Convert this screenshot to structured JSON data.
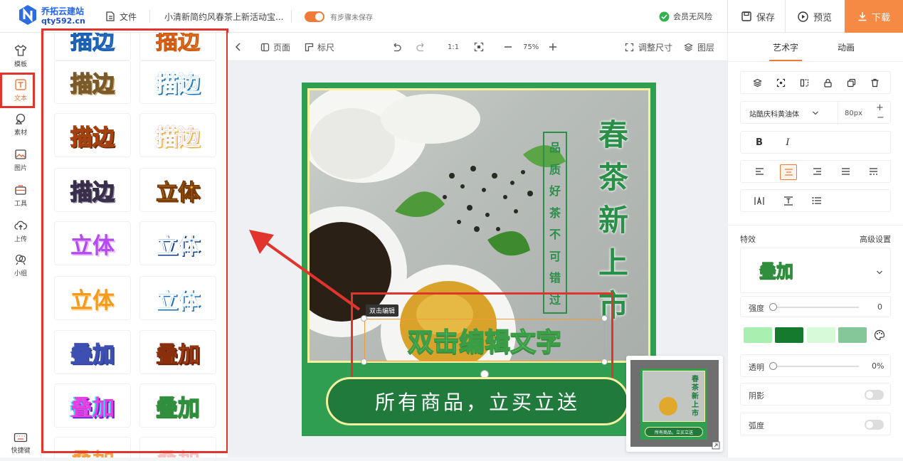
{
  "topbar": {
    "logo_line1": "乔拓云建站",
    "logo_line2": "qty592.cn",
    "file_label": "文件",
    "doc_title": "小清新简约风春茶上新活动宝...",
    "autosave_label": "有步骤未保存",
    "member_label": "会员无风险",
    "save_label": "保存",
    "preview_label": "预览",
    "download_label": "下载",
    "accent": "#f58a45"
  },
  "leftnav": {
    "items": [
      {
        "label": "模板",
        "icon": "shirt-icon"
      },
      {
        "label": "文本",
        "icon": "text-icon"
      },
      {
        "label": "素材",
        "icon": "shapes-icon"
      },
      {
        "label": "图片",
        "icon": "image-icon"
      },
      {
        "label": "工具",
        "icon": "toolbox-icon"
      },
      {
        "label": "上传",
        "icon": "upload-cloud-icon"
      },
      {
        "label": "小组",
        "icon": "team-icon"
      }
    ],
    "shortcut_label": "快捷键"
  },
  "panel": {
    "tiles": [
      "描边",
      "描边",
      "描边",
      "描边",
      "描边",
      "立体",
      "立体",
      "立体",
      "立体",
      "立体",
      "叠加",
      "叠加",
      "叠加",
      "叠加"
    ]
  },
  "canvas_toolbar": {
    "page_label": "页面",
    "ruler_label": "标尺",
    "ratio_label": "1:1",
    "zoom_value": "75%",
    "resize_label": "调整尺寸",
    "layers_label": "图层"
  },
  "poster": {
    "title_chars": [
      "春",
      "茶",
      "新",
      "上",
      "市"
    ],
    "slogan_chars": [
      "品",
      "质",
      "好",
      "茶",
      "不",
      "可",
      "错",
      "过"
    ],
    "edit_text": "双击编辑文字",
    "edit_tag": "双击编辑",
    "banner": "所有商品，立买立送",
    "green": "#2f9e51"
  },
  "thumbnail": {
    "title": "春茶新上市",
    "banner": "所有商品，立买立送"
  },
  "rpanel": {
    "tab_art": "艺术字",
    "tab_anim": "动画",
    "font_name": "站酷庆科黄油体",
    "font_size": "80px",
    "bold_label": "B",
    "italic_label": "I",
    "effect_label": "特效",
    "advanced_label": "高级设置",
    "effect_preview": "叠加",
    "strength_label": "强度",
    "strength_value": "0",
    "opacity_label": "透明",
    "opacity_value": "0%",
    "shadow_label": "阴影",
    "arc_label": "弧度",
    "swatches": [
      "#a8efb0",
      "#157a2e",
      "#d7fbd9",
      "#86c79a"
    ]
  }
}
